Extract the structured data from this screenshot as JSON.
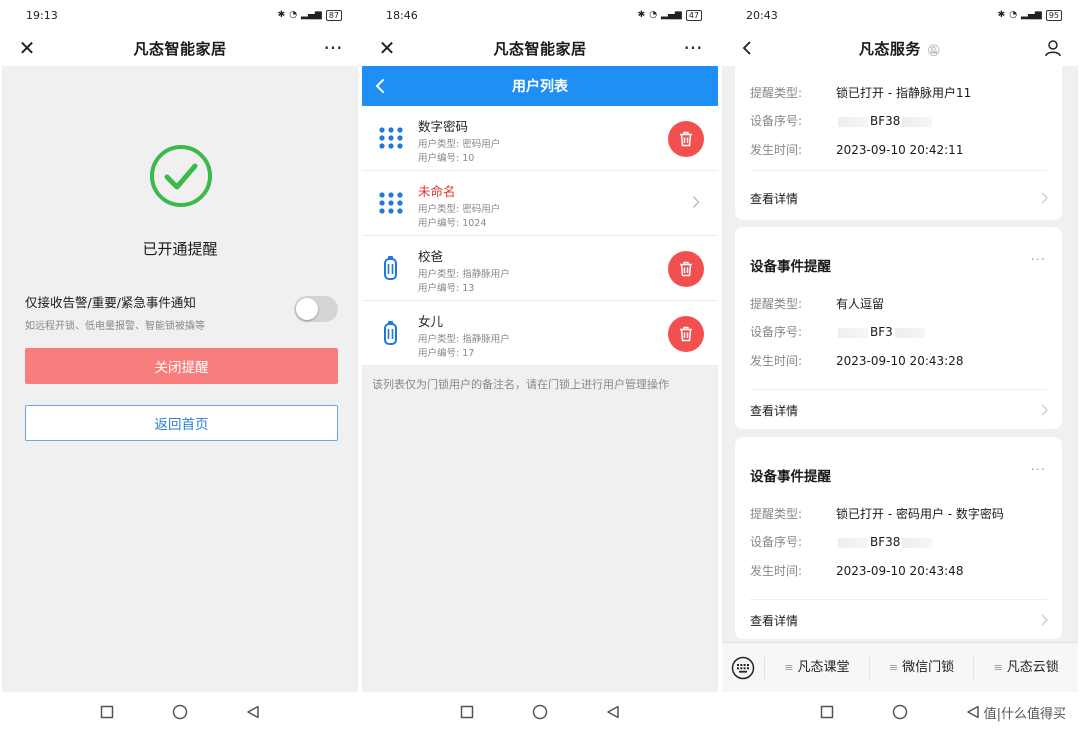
{
  "phone1": {
    "status": {
      "time": "19:13",
      "battery": "87"
    },
    "nav": {
      "title": "凡态智能家居"
    },
    "success_title": "已开通提醒",
    "option": {
      "main": "仅接收告警/重要/紧急事件通知",
      "sub": "如远程开锁、低电量报警、智能锁被撬等",
      "toggle_on": false
    },
    "close_button": "关闭提醒",
    "home_button": "返回首页"
  },
  "phone2": {
    "status": {
      "time": "18:46",
      "battery": "47"
    },
    "nav": {
      "title": "凡态智能家居"
    },
    "header_title": "用户列表",
    "users": [
      {
        "name": "数字密码",
        "type": "用户类型: 密码用户",
        "num": "用户编号: 10",
        "icon": "keypad-icon",
        "action": "delete"
      },
      {
        "name": "未命名",
        "type": "用户类型: 密码用户",
        "num": "用户编号: 1024",
        "icon": "keypad-icon",
        "action": "chevron"
      },
      {
        "name": "校爸",
        "type": "用户类型: 指静脉用户",
        "num": "用户编号: 13",
        "icon": "finger-vein-icon",
        "action": "delete"
      },
      {
        "name": "女儿",
        "type": "用户类型: 指静脉用户",
        "num": "用户编号: 17",
        "icon": "finger-vein-icon",
        "action": "delete"
      }
    ],
    "note": "该列表仅为门锁用户的备注名，请在门锁上进行用户管理操作"
  },
  "phone3": {
    "status": {
      "time": "20:43",
      "battery": "95"
    },
    "nav": {
      "title": "凡态服务"
    },
    "cards": [
      {
        "title": "",
        "rows": [
          {
            "k": "提醒类型:",
            "v": "锁已打开 - 指静脉用户11"
          },
          {
            "k": "设备序号:",
            "v": "BF38"
          },
          {
            "k": "发生时间:",
            "v": "2023-09-10 20:42:11"
          }
        ],
        "detail": "查看详情"
      },
      {
        "title": "设备事件提醒",
        "rows": [
          {
            "k": "提醒类型:",
            "v": "有人逗留"
          },
          {
            "k": "设备序号:",
            "v": "BF3"
          },
          {
            "k": "发生时间:",
            "v": "2023-09-10 20:43:28"
          }
        ],
        "detail": "查看详情"
      },
      {
        "title": "设备事件提醒",
        "rows": [
          {
            "k": "提醒类型:",
            "v": "锁已打开 - 密码用户 - 数字密码"
          },
          {
            "k": "设备序号:",
            "v": "BF38"
          },
          {
            "k": "发生时间:",
            "v": "2023-09-10 20:43:48"
          }
        ],
        "detail": "查看详情"
      }
    ],
    "tabs": [
      "凡态课堂",
      "微信门锁",
      "凡态云锁"
    ],
    "watermark": "值|什么值得买"
  },
  "colors": {
    "accent_blue": "#1f8ff5",
    "danger_red": "#f24f4f",
    "close_button": "#f77e7c",
    "success_green": "#3bb94b"
  }
}
